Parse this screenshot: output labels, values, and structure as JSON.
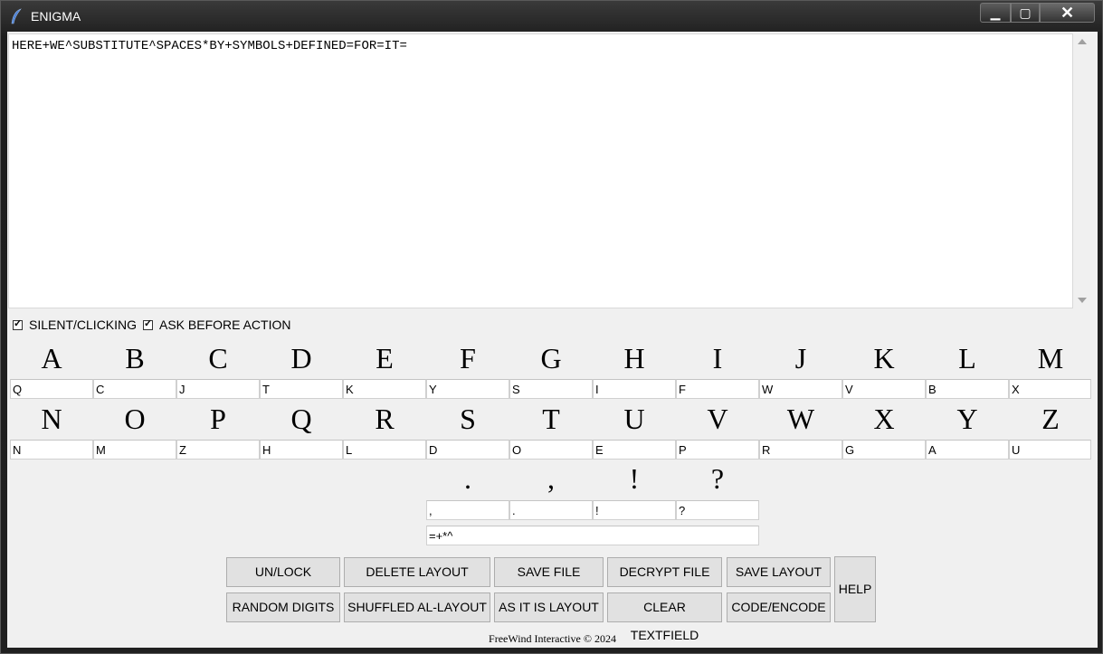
{
  "window": {
    "title": "ENIGMA",
    "minimize": "▁",
    "maximize": "▢",
    "close": "✕"
  },
  "textfield": {
    "value": "HERE+WE^SUBSTITUTE^SPACES*BY+SYMBOLS+DEFINED=FOR=IT="
  },
  "options": {
    "silent_clicking": {
      "label": "SILENT/CLICKING",
      "checked": true
    },
    "ask_before_action": {
      "label": "ASK BEFORE ACTION",
      "checked": true
    }
  },
  "row1": {
    "letters": [
      "A",
      "B",
      "C",
      "D",
      "E",
      "F",
      "G",
      "H",
      "I",
      "J",
      "K",
      "L",
      "M"
    ],
    "values": [
      "Q",
      "C",
      "J",
      "T",
      "K",
      "Y",
      "S",
      "I",
      "F",
      "W",
      "V",
      "B",
      "X"
    ]
  },
  "row2": {
    "letters": [
      "N",
      "O",
      "P",
      "Q",
      "R",
      "S",
      "T",
      "U",
      "V",
      "W",
      "X",
      "Y",
      "Z"
    ],
    "values": [
      "N",
      "M",
      "Z",
      "H",
      "L",
      "D",
      "O",
      "E",
      "P",
      "R",
      "G",
      "A",
      "U"
    ]
  },
  "punctuation": {
    "symbols": [
      ".",
      ",",
      "!",
      "?"
    ],
    "values": [
      ",",
      ".",
      "!",
      "?"
    ],
    "space_symbols": "=+*^"
  },
  "buttons": {
    "unlock": "UN/LOCK",
    "delete_layout": "DELETE LAYOUT",
    "save_file": "SAVE FILE",
    "decrypt_file": "DECRYPT FILE",
    "save_layout": "SAVE LAYOUT",
    "random_digits": "RANDOM DIGITS",
    "shuffled_layout": "SHUFFLED AL-LAYOUT",
    "as_it_is_layout": "AS IT IS LAYOUT",
    "clear_textfield": "CLEAR TEXTFIELD",
    "code_encode": "CODE/ENCODE",
    "help": "HELP"
  },
  "footer": "FreeWind Interactive © 2024"
}
